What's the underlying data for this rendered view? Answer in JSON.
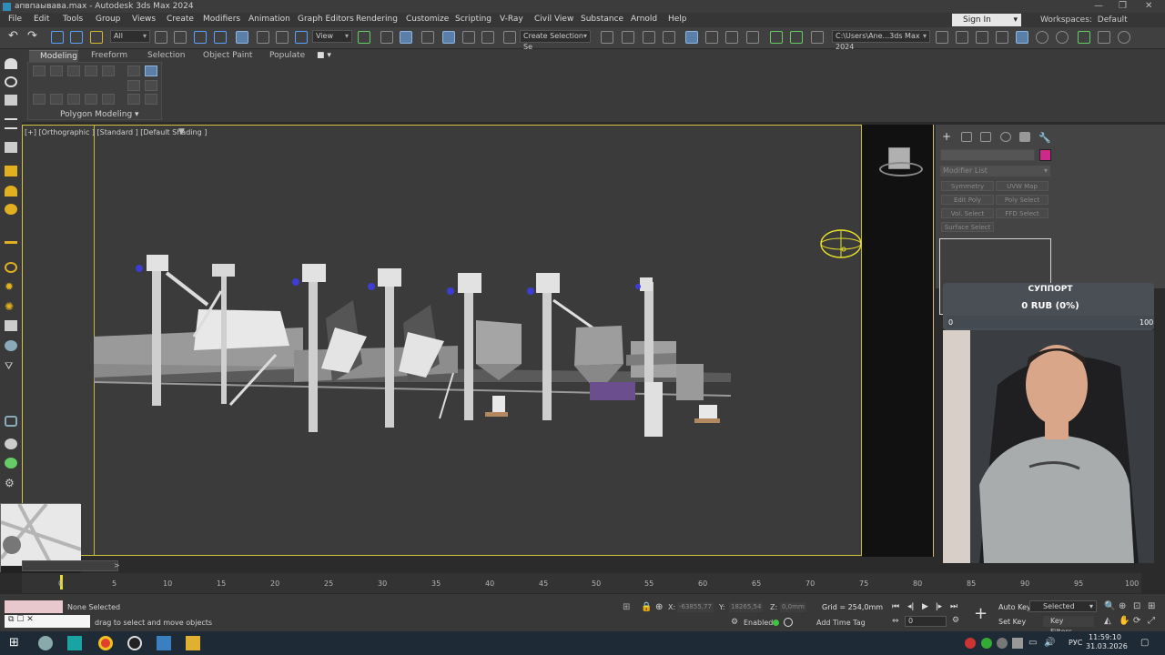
{
  "window": {
    "title": "апвпаывава.max - Autodesk 3ds Max 2024",
    "controls": [
      "—",
      "❐",
      "✕"
    ]
  },
  "menu": {
    "items": [
      "File",
      "Edit",
      "Tools",
      "Group",
      "Views",
      "Create",
      "Modifiers",
      "Animation",
      "Graph Editors",
      "Rendering",
      "Customize",
      "Scripting",
      "V-Ray",
      "Civil View",
      "Substance",
      "Arnold",
      "Help"
    ],
    "sign_in": "Sign In",
    "workspaces_label": "Workspaces:",
    "workspaces_value": "Default"
  },
  "toolbar": {
    "filter_value": "All",
    "refcoord_value": "View",
    "selection_set_value": "Create Selection Se",
    "project_path": "C:\\Users\\Ane...3ds Max 2024"
  },
  "ribbon": {
    "tabs": [
      "Modeling",
      "Freeform",
      "Selection",
      "Object Paint",
      "Populate"
    ],
    "panel_label": "Polygon Modeling"
  },
  "viewport": {
    "label": "[+] [Orthographic ] [Standard ] [Default Shading ]"
  },
  "command_panel": {
    "modifier_list_placeholder": "Modifier List",
    "modifier_buttons": [
      "Symmetry",
      "UVW Map",
      "Edit Poly",
      "Poly Select",
      "Vol. Select",
      "FFD Select",
      "Surface Select"
    ],
    "object_color": "#cc2a8a"
  },
  "donation": {
    "title": "СУППОРТ",
    "amount": "0 RUB (0%)",
    "min": "0",
    "max": "100",
    "progress_percent": 0
  },
  "timeline": {
    "slider_label": ">",
    "ticks": [
      "0",
      "5",
      "10",
      "15",
      "20",
      "25",
      "30",
      "35",
      "40",
      "45",
      "50",
      "55",
      "60",
      "65",
      "70",
      "75",
      "80",
      "85",
      "90",
      "95",
      "100"
    ]
  },
  "status": {
    "selection": "None Selected",
    "hint": "drag to select and move objects",
    "x_label": "X:",
    "x_value": "-63855,77",
    "y_label": "Y:",
    "y_value": "18265,54",
    "z_label": "Z:",
    "z_value": "0,0mm",
    "grid": "Grid = 254,0mm",
    "enabled_label": "Enabled:",
    "add_time_tag": "Add Time Tag",
    "auto_key": "Auto Key",
    "set_key": "Set Key",
    "selected_dd": "Selected",
    "key_filters": "Key Filters...",
    "frame_value": "0"
  },
  "taskbar": {
    "time": "11:59:10",
    "date": "31.03.2026",
    "language": "РУС"
  }
}
